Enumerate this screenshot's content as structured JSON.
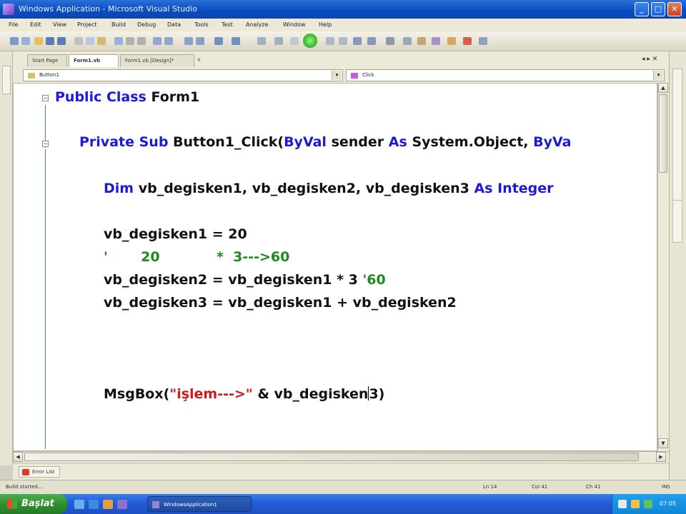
{
  "window": {
    "title": "Windows Application - Microsoft Visual Studio",
    "minimize": "_",
    "maximize": "□",
    "close": "✕"
  },
  "menu": [
    "File",
    "Edit",
    "View",
    "Project",
    "Build",
    "Debug",
    "Data",
    "Tools",
    "Test",
    "Analyze",
    "Window",
    "Help"
  ],
  "tabs": {
    "start_page": "Start Page",
    "form1_vb": "Form1.vb",
    "form1_design": "Form1.vb [Design]*",
    "close": "x",
    "nav": "◂ ▸ ✕"
  },
  "dropdowns": {
    "object": "Button1",
    "event": "Click",
    "arrow": "▾"
  },
  "code": {
    "line1": {
      "kw1": "Public",
      "kw2": "Class",
      "text": "Form1"
    },
    "line2": {
      "kw1": "Private",
      "kw2": "Sub",
      "name": "Button1_Click(",
      "kw3": "ByVal",
      "p1": "sender",
      "kw4": "As",
      "t1": "System.Object,",
      "kw5": "ByVa"
    },
    "line3": {
      "kw1": "Dim",
      "vars": "vb_degisken1, vb_degisken2, vb_degisken3",
      "kw2": "As",
      "kw3": "Integer"
    },
    "line4": "vb_degisken1 = 20",
    "line5": "'       20            *  3--->60",
    "line6": {
      "code": "vb_degisken2 = vb_degisken1 * 3 ",
      "comment": "'60"
    },
    "line7": "vb_degisken3 = vb_degisken1 + vb_degisken2",
    "line8": {
      "pre": "MsgBox(",
      "str": "\"işlem--->\"",
      "mid": " & vb_degisken",
      "post": "3)"
    },
    "collapse_marker": "−"
  },
  "bottom": {
    "error_list": "Error List"
  },
  "status": {
    "left": "Build started...",
    "ln": "Ln 14",
    "col": "Col 41",
    "ch": "Ch 41",
    "mode": "INS"
  },
  "taskbar": {
    "start": "Başlat",
    "task": "WindowsApplication1",
    "clock": "07:05"
  },
  "colors": {
    "keyword": "#1a1ad8",
    "comment": "#1f8a1f",
    "string": "#cc1a1a"
  }
}
